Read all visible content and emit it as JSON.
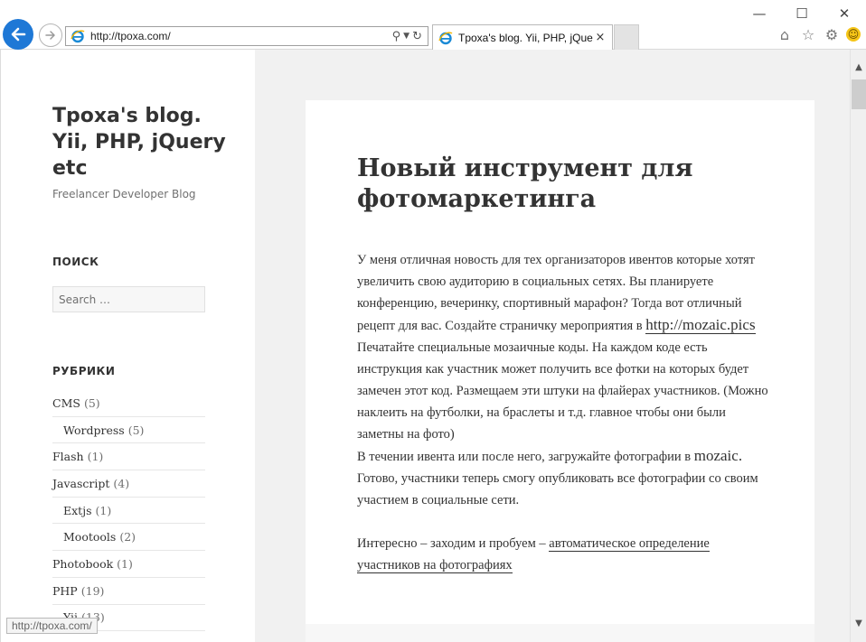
{
  "browser": {
    "address_url": "http://tpoxa.com/",
    "tab_title": "Tpoxa's blog. Yii, PHP, jQue...",
    "tab_close": "×",
    "window_controls": {
      "minimize": "—",
      "maximize": "☐",
      "close": "✕"
    },
    "toolbar_icons": [
      "home-icon",
      "favorites-star-icon",
      "gear-icon",
      "smiley-feedback-icon"
    ],
    "accent_color": "#1e78d6"
  },
  "sidebar": {
    "site_title": "Tpoxa's blog. Yii, PHP, jQuery etc",
    "site_description": "Freelancer Developer Blog",
    "search": {
      "heading": "ПОИСК",
      "placeholder": "Search …"
    },
    "categories": {
      "heading": "РУБРИКИ",
      "items": [
        {
          "label": "CMS",
          "count": "(5)",
          "child": false
        },
        {
          "label": "Wordpress",
          "count": "(5)",
          "child": true
        },
        {
          "label": "Flash",
          "count": "(1)",
          "child": false
        },
        {
          "label": "Javascript",
          "count": "(4)",
          "child": false
        },
        {
          "label": "Extjs",
          "count": "(1)",
          "child": true
        },
        {
          "label": "Mootools",
          "count": "(2)",
          "child": true
        },
        {
          "label": "Photobook",
          "count": "(1)",
          "child": false
        },
        {
          "label": "PHP",
          "count": "(19)",
          "child": false
        },
        {
          "label": "Yii",
          "count": "(13)",
          "child": true
        }
      ]
    }
  },
  "post": {
    "title": "Новый инструмент для фотомаркетинга",
    "p1_a": "У меня отличная новость для тех организаторов ивентов которые хотят увеличить свою аудиторию в социальных сетях. Вы планируете конференцию, вечеринку, спортивный марафон? Тогда вот отличный рецепт для вас. Создайте страничку мероприятия в ",
    "p1_link": "http://mozaic.pics",
    "p2": "Печатайте специальные мозаичные коды. На каждом коде есть инструкция как участник может получить все фотки на которых будет замечен этот код. Размещаем эти штуки на флайерах участников. (Можно наклеить на футболки, на браслеты и т.д. главное чтобы они были заметны на фото)",
    "p3_a": "В течении ивента или после него, загружайте фотографии в ",
    "p3_brand": "mozaic.",
    "p3_b": " Готово, участники теперь смогу опубликовать все фотографии со своим участием в социальные сети.",
    "p4_a": "Интересно – заходим и пробуем – ",
    "p4_link": "автоматическое определение участников на фотографиях"
  },
  "status_bar": {
    "hover_url": "http://tpoxa.com/"
  }
}
